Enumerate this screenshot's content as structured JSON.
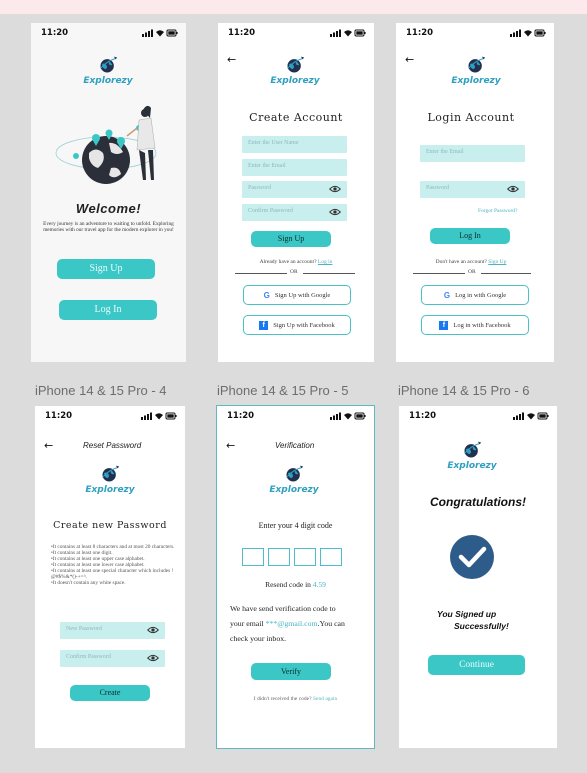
{
  "status": {
    "time": "11:20"
  },
  "brand": "Explorezy",
  "captions": [
    "iPhone 14 & 15 Pro - 4",
    "iPhone 14 & 15 Pro - 5",
    "iPhone 14 & 15 Pro - 6"
  ],
  "welcome": {
    "title": "Welcome!",
    "body": "Every journey is an adventure to waiting to unfold. Exploring memories with our travel app for the modern explorer in you!",
    "signup": "Sign Up",
    "login": "Log In"
  },
  "create": {
    "title": "Create Account",
    "username_ph": "Enter the User Name",
    "email_ph": "Enter the Email",
    "password_ph": "Password",
    "confirm_ph": "Confirm Password",
    "signup": "Sign Up",
    "have_account": "Already have an account?",
    "login_link": "Log in",
    "or": "OR",
    "google": "Sign Up with Google",
    "facebook": "Sign Up with Facebook"
  },
  "login": {
    "title": "Login Account",
    "email_ph": "Enter the Email",
    "password_ph": "Password",
    "forgot": "Forgot Password?",
    "login": "Log In",
    "no_account": "Don't have an account?",
    "signup_link": "Sign Up",
    "or": "OR",
    "google": "Log in with Google",
    "facebook": "Log in with Facebook"
  },
  "reset": {
    "header": "Reset Password",
    "title": "Create new Password",
    "rules": [
      "•It contains at least 8 characters and at most 20 characters.",
      "•It contains at least one digit.",
      "•It contains at least one upper case alphabet.",
      "•It contains at least one lower case alphabet.",
      "•It contains at least one special character which includes ! @#$%&*()-+=^.",
      "•It doesn't contain any white space."
    ],
    "new_ph": "New Password",
    "confirm_ph": "Confirm Password",
    "create": "Create"
  },
  "verify": {
    "header": "Verification",
    "prompt": "Enter your 4 digit code",
    "resend_prefix": "Resend code in",
    "resend_time": "4.59",
    "msg_line1": "We have send verification code to",
    "msg_line2_pre": "your email",
    "msg_email": "***@gmail.com",
    "msg_line2_post": ".You can",
    "msg_line3": "check your inbox.",
    "verify": "Verify",
    "not_received": "I didn't received the code?",
    "send_again": "Send again"
  },
  "congrats": {
    "title": "Congratulations!",
    "line1": "You Signed up",
    "line2": "Successfully!",
    "continue": "Continue"
  }
}
